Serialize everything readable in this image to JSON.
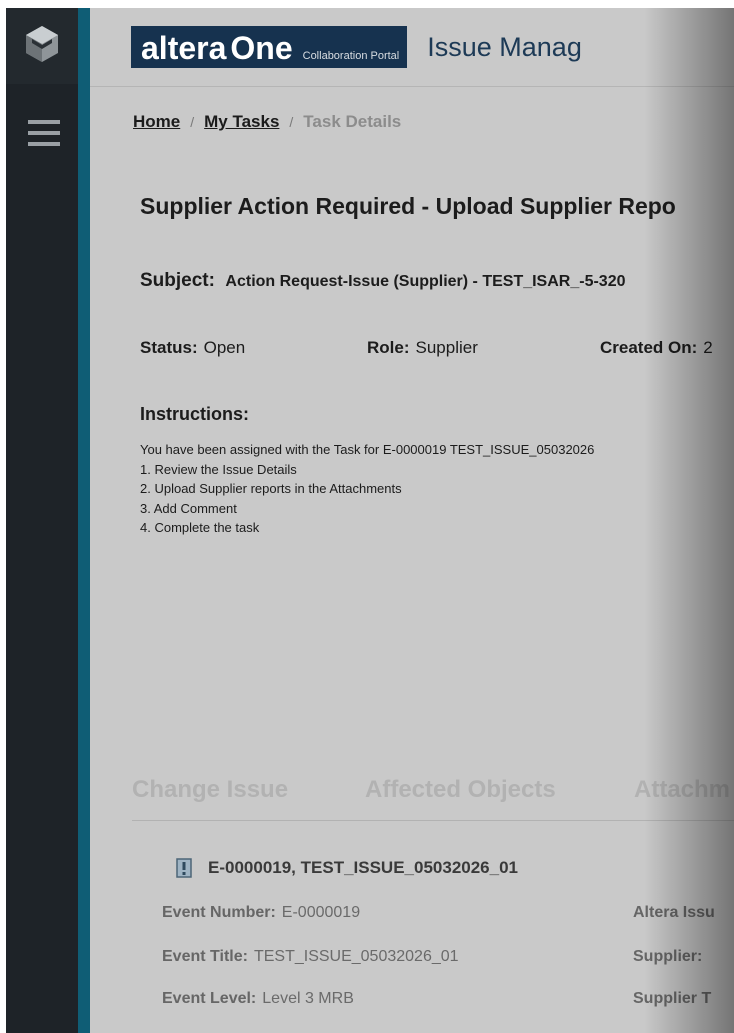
{
  "header": {
    "brand_word": "altera",
    "brand_one": "One",
    "brand_sub": "Collaboration Portal",
    "app_title": "Issue Manag"
  },
  "breadcrumb": {
    "home": "Home",
    "sep1": "/",
    "my_tasks": "My Tasks",
    "sep2": "/",
    "current": "Task Details"
  },
  "task": {
    "title": "Supplier Action Required - Upload Supplier Repo",
    "subject_label": "Subject:",
    "subject_value": "Action Request-Issue (Supplier) - TEST_ISAR_-5-320",
    "status_label": "Status:",
    "status_value": "Open",
    "role_label": "Role:",
    "role_value": "Supplier",
    "created_label": "Created On:",
    "created_value": "2",
    "instructions_label": "Instructions:",
    "instructions": [
      "You have been assigned with the Task for E-0000019 TEST_ISSUE_05032026",
      "1. Review the Issue Details",
      "2. Upload Supplier reports in the Attachments",
      "3. Add Comment",
      "4. Complete the task"
    ]
  },
  "tabs": [
    "Change Issue",
    "Affected Objects",
    "Attachm"
  ],
  "issue": {
    "heading": "E-0000019, TEST_ISSUE_05032026_01",
    "fields": {
      "event_number_label": "Event Number:",
      "event_number_value": "E-0000019",
      "event_title_label": "Event Title:",
      "event_title_value": "TEST_ISSUE_05032026_01",
      "event_level_label": "Event Level:",
      "event_level_value": "Level 3 MRB",
      "altera_issue_label": "Altera Issu",
      "supplier_label": "Supplier:",
      "supplier_t_label": "Supplier T"
    }
  },
  "icons": {
    "logo": "altera-cube-logo-icon",
    "menu": "hamburger-menu-icon",
    "issue": "document-icon"
  },
  "colors": {
    "sidebar": "#1e2328",
    "accent": "#0f5d75",
    "brand_bg": "#16324f",
    "content_bg": "#c9c9c9"
  }
}
